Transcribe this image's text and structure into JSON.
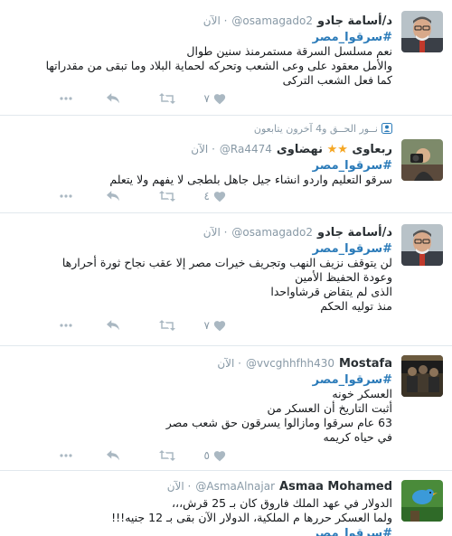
{
  "tweets": [
    {
      "name": "د/أسامة جادو",
      "handle": "@osamagado2",
      "time": "الآن",
      "hashtag": "#سرقوا_مصر",
      "lines": [
        "نعم مسلسل السرقة مستمرمنذ سنين طوال",
        "والأمل معقود على وعى الشعب وتحركه لحماية البلاد وما تبقى من مقدراتها",
        "كما فعل الشعب التركى"
      ],
      "likes": "٧",
      "avatar": "man-with-glasses-portrait"
    },
    {
      "context": "نــور الحــق  و4 آخرون يتابعون",
      "name_a": "ربعاوى",
      "name_b": "نهضاوى",
      "handle": "@Ra4474",
      "time": "الآن",
      "hashtag": "#سرقوا_مصر",
      "lines": [
        "سرقو التعليم واردو انشاء جيل جاهل بلطجى لا يفهم ولا يتعلم"
      ],
      "likes": "٤",
      "avatar": "photographer-with-camera"
    },
    {
      "name": "د/أسامة جادو",
      "handle": "@osamagado2",
      "time": "الآن",
      "hashtag": "#سرقوا_مصر",
      "lines": [
        "لن يتوقف نزيف النهب وتجريف خيرات مصر إلا عقب نجاح ثورة أحرارها",
        "وعودة الحفيظ الأمين",
        "الذى لم يتقاض قرشاواحدا",
        "منذ توليه الحكم"
      ],
      "likes": "٧",
      "avatar": "man-with-glasses-portrait"
    },
    {
      "name": "Mostafa",
      "handle": "@vvcghhfhh430",
      "time": "الآن",
      "hashtag": "#سرقوا_مصر",
      "lines": [
        "العسكر خونه",
        "أثبت التاريخ أن العسكر من",
        "63 عام سرقوا ومازالوا يسرقون حق شعب مصر",
        "في حياه كريمه"
      ],
      "likes": "٥",
      "avatar": "dark-group-photo"
    },
    {
      "name": "Asmaa Mohamed",
      "handle": "@AsmaAlnajar",
      "time": "الآن",
      "lines": [
        "الدولار في عهد الملك فاروق كان بـ 25 قرش،،،",
        "ولما العسكر حررها م الملكية، الدولار الآن بقى بـ 12 جنيه!!!"
      ],
      "hashtag": "#سرقوا_مصر",
      "avatar": "bird-on-green"
    }
  ],
  "colors": {
    "link": "#2b7bb9",
    "muted": "#8899a6",
    "icon": "#aab8c2",
    "star": "#f5a623"
  }
}
